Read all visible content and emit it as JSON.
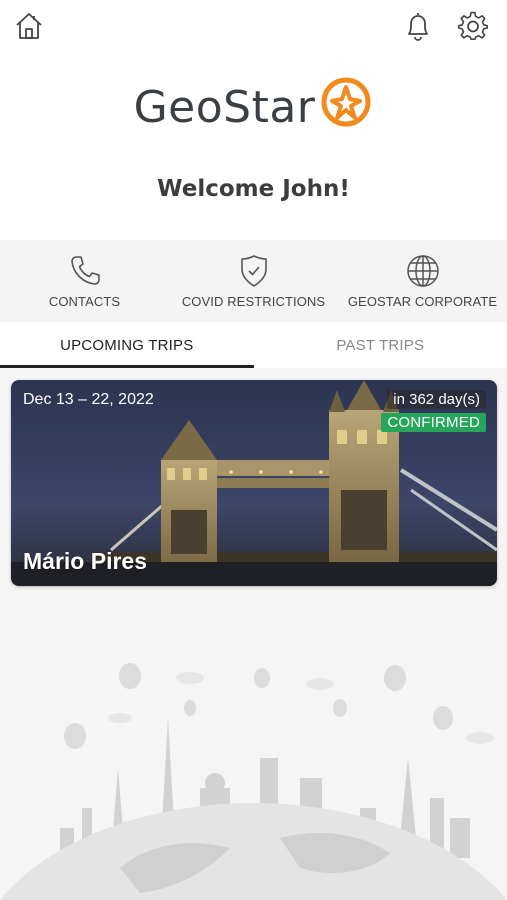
{
  "topbar": {
    "home_icon": "home-icon",
    "bell_icon": "bell-icon",
    "settings_icon": "gear-icon"
  },
  "brand": {
    "name": "GeoStar",
    "accent_color": "#f28a1e",
    "text_color": "#3a3f44"
  },
  "welcome": "Welcome John!",
  "quick_links": [
    {
      "label": "CONTACTS",
      "icon": "phone-icon"
    },
    {
      "label": "COVID RESTRICTIONS",
      "icon": "shield-check-icon"
    },
    {
      "label": "GEOSTAR CORPORATE",
      "icon": "globe-icon"
    }
  ],
  "tabs": [
    {
      "label": "UPCOMING TRIPS",
      "active": true
    },
    {
      "label": "PAST TRIPS",
      "active": false
    }
  ],
  "trips": [
    {
      "dates": "Dec 13 – 22, 2022",
      "countdown": "in 362 day(s)",
      "status": "CONFIRMED",
      "status_color": "#26a65b",
      "traveler": "Mário Pires",
      "image": "tower-bridge-night"
    }
  ]
}
